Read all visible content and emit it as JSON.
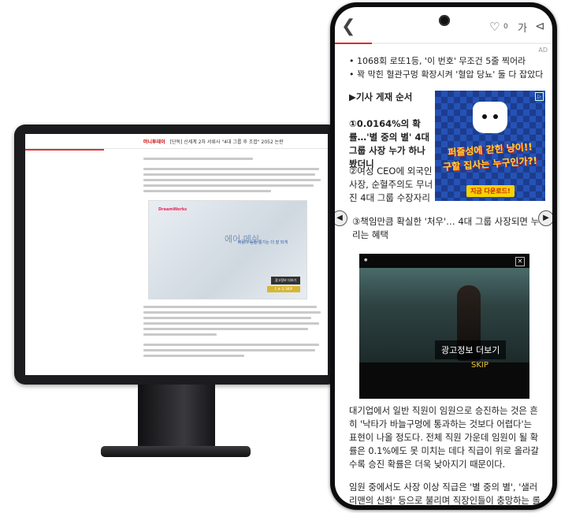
{
  "desktop": {
    "site_logo": "머니투데이",
    "article_headline": "[단독] 신세계 2차 서류사 \"4대 그룹 후 조합\" 2052 논란",
    "image_title": "에어 메쉬",
    "image_subtitle": "바람이 숨술 통기는 더 잘 되게",
    "image_brand": "DreamWorks",
    "ad_info_button": "광고정보 더보기",
    "skip_button": "1 초 후 SKIP"
  },
  "phone": {
    "header": {
      "back_icon": "chevron-left-icon",
      "like_count": "0",
      "font_size_label": "가",
      "share_icon": "share-icon"
    },
    "progress": 0.17,
    "ad_label": "AD",
    "news_items": [
      "• 1068회 로또1등, '이 번호' 무조건 5줄 찍어라",
      "• 꽉 막힌 혈관구멍 확장시켜 '혈압 당뇨' 둘 다 잡았다"
    ],
    "order_title": "▶기사 게재 순서",
    "order_items": [
      "①0.0164%의 확률…'별 중의 별' 4대 그룹 사장 누가 하나 봤더니",
      "②여성 CEO에 외국인 사장, 순혈주의도 무너진 4대 그룹 수장자리",
      "③책임만큼 확실한 '처우'… 4대 그룹 사장되면 누리는 혜택"
    ],
    "banner_ad": {
      "line1": "퍼즐성에 갇힌 냥이!!",
      "line2": "구할 집사는 누구인가?!",
      "cta": "지금 다운로드!"
    },
    "video_ad": {
      "ad_info": "광고정보 더보기",
      "skip": "SKIP"
    },
    "paragraphs": [
      "대기업에서 일반 직원이 임원으로 승진하는 것은 흔히 '낙타가 바늘구멍에 통과하는 것보다 어렵다'는 표현이 나올 정도다. 전체 직원 가운데 임원이 될 확률은 0.1%에도 못 미치는 데다 직급이 위로 올라갈수록 승진 확률은 더욱 낮아지기 때문이다.",
      "임원 중에서도 사장 이상 직급은 '별 중의 별', '샐러리맨의 신화' 등으로 불리며 직장인들이 충망하는 롤 모델이 되"
    ]
  }
}
